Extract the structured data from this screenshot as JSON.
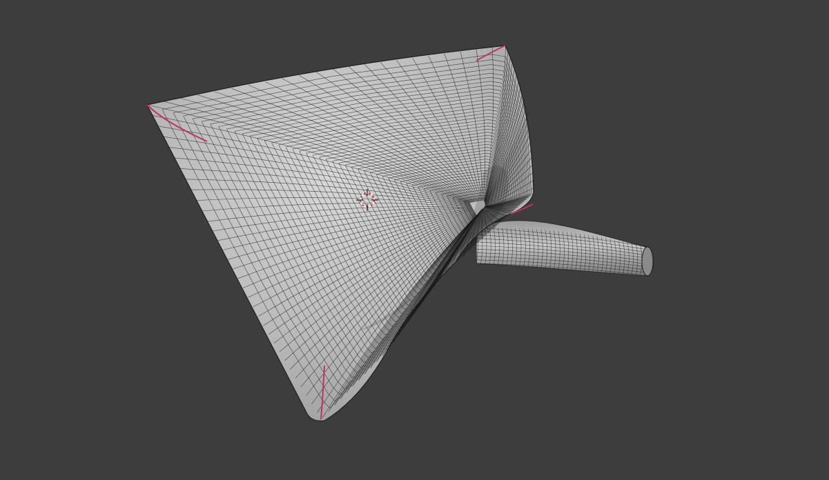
{
  "viewport": {
    "background_color": "#3d3d3d",
    "shading_mode": "solid",
    "overlay": "wireframe"
  },
  "mesh": {
    "shape": "funnel",
    "surface_color": "#bdbdbd",
    "surface_light_color": "#d6d6d6",
    "surface_shadow_color": "#8c8c8c",
    "wire_color": "#1a1a1a",
    "seam_color": "#c0306a"
  },
  "cursor_3d": {
    "icon": "3d-cursor-icon",
    "ring_color_a": "#e03c3c",
    "ring_color_b": "#ffffff"
  }
}
